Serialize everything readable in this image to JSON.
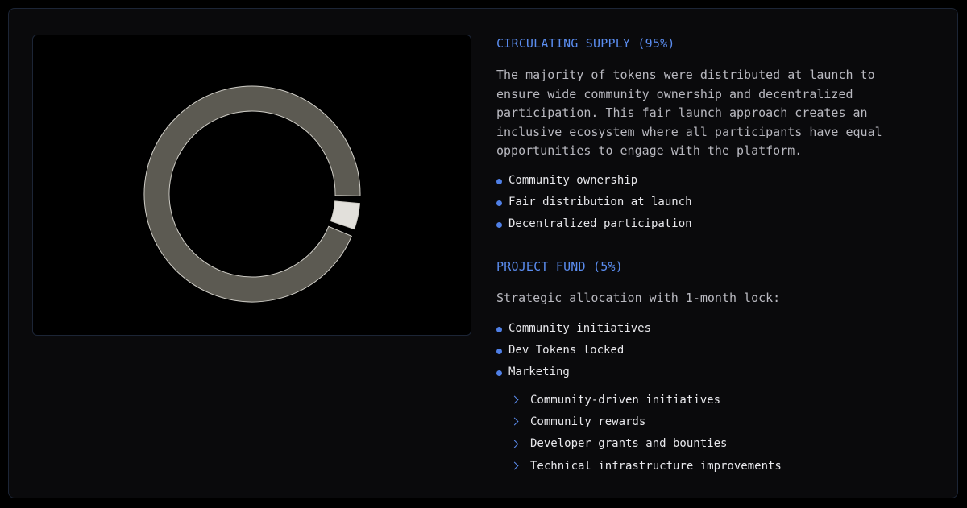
{
  "chart_data": {
    "type": "pie",
    "donut": true,
    "slices": [
      {
        "label": "Circulating Supply",
        "value": 95,
        "color": "#5c5a52"
      },
      {
        "label": "Project Fund",
        "value": 5,
        "color": "#e2e0db"
      }
    ]
  },
  "circulating": {
    "title": "CIRCULATING SUPPLY (95%)",
    "paragraph": "The majority of tokens were distributed at launch to ensure wide community ownership and decentralized participation. This fair launch approach creates an inclusive ecosystem where all participants have equal opportunities to engage with the platform.",
    "bullets": [
      "Community ownership",
      "Fair distribution at launch",
      "Decentralized participation"
    ]
  },
  "project_fund": {
    "title": "PROJECT FUND (5%)",
    "intro": "Strategic allocation with 1-month lock:",
    "bullets": [
      "Community initiatives",
      "Dev Tokens locked",
      "Marketing"
    ],
    "sub_bullets": [
      "Community-driven initiatives",
      "Community rewards",
      "Developer grants and bounties",
      "Technical infrastructure improvements"
    ]
  },
  "colors": {
    "accent": "#5b8df0",
    "bullet": "#4f7fe6",
    "slice_main": "#5c5a52",
    "slice_highlight": "#e2e0db"
  }
}
